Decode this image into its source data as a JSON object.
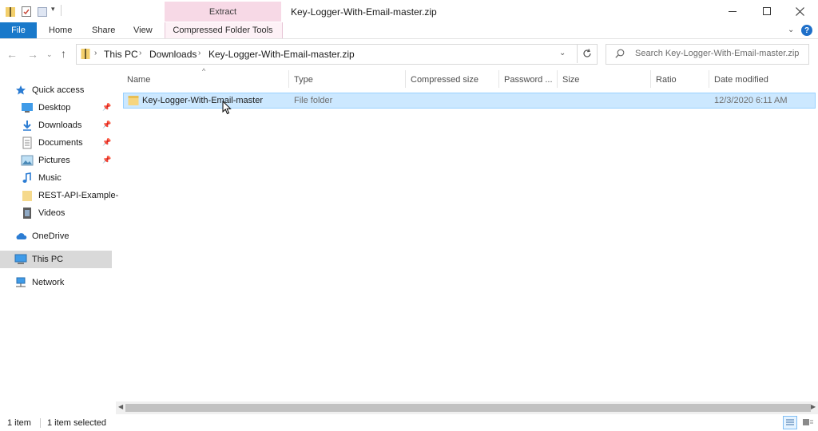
{
  "window": {
    "title": "Key-Logger-With-Email-master.zip",
    "contextual_tab": "Extract",
    "contextual_group": "Compressed Folder Tools"
  },
  "ribbon": {
    "tabs": [
      "File",
      "Home",
      "Share",
      "View"
    ]
  },
  "address": {
    "crumbs": [
      "This PC",
      "Downloads",
      "Key-Logger-With-Email-master.zip"
    ]
  },
  "search": {
    "placeholder": "Search Key-Logger-With-Email-master.zip"
  },
  "sidebar": {
    "quick_access": "Quick access",
    "items": [
      {
        "label": "Desktop",
        "icon": "desktop-icon",
        "pinned": true
      },
      {
        "label": "Downloads",
        "icon": "download-icon",
        "pinned": true
      },
      {
        "label": "Documents",
        "icon": "documents-icon",
        "pinned": true
      },
      {
        "label": "Pictures",
        "icon": "pictures-icon",
        "pinned": true
      },
      {
        "label": "Music",
        "icon": "music-icon",
        "pinned": false
      },
      {
        "label": "REST-API-Example-",
        "icon": "folder-icon",
        "pinned": false
      },
      {
        "label": "Videos",
        "icon": "videos-icon",
        "pinned": false
      }
    ],
    "onedrive": "OneDrive",
    "this_pc": "This PC",
    "network": "Network"
  },
  "columns": [
    "Name",
    "Type",
    "Compressed size",
    "Password ...",
    "Size",
    "Ratio",
    "Date modified"
  ],
  "files": [
    {
      "name": "Key-Logger-With-Email-master",
      "type": "File folder",
      "date": "12/3/2020 6:11 AM",
      "selected": true
    }
  ],
  "status": {
    "count": "1 item",
    "selected": "1 item selected"
  },
  "colors": {
    "accent": "#1979ca",
    "selection": "#cce8ff",
    "contextual": "#f7d9e6"
  }
}
